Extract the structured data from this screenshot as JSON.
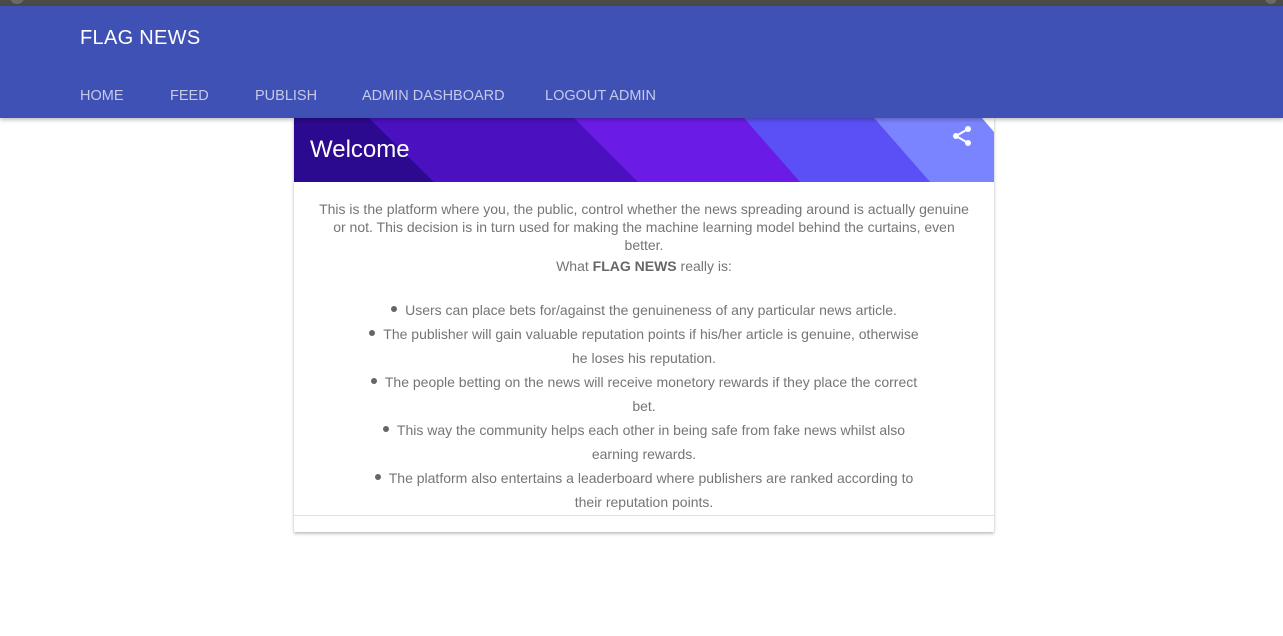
{
  "app": {
    "brand": "FLAG NEWS"
  },
  "nav": {
    "items": [
      {
        "label": "HOME"
      },
      {
        "label": "FEED"
      },
      {
        "label": "PUBLISH"
      },
      {
        "label": "ADMIN DASHBOARD"
      },
      {
        "label": "LOGOUT ADMIN"
      }
    ]
  },
  "card": {
    "title": "Welcome",
    "share_icon": "share-icon",
    "intro": "This is the platform where you, the public, control whether the news spreading around is actually genuine or not. This decision is in turn used for making the machine learning model behind the curtains, even better.",
    "whatis_prefix": "What",
    "whatis_brand": "FLAG NEWS",
    "whatis_suffix": "really is:",
    "features": [
      "Users can place bets for/against the genuineness of any particular news article.",
      "The publisher will gain valuable reputation points if his/her article is genuine, otherwise he loses his reputation.",
      "The people betting on the news will receive monetory rewards if they place the correct bet.",
      "This way the community helps each other in being safe from fake news whilst also earning rewards.",
      "The platform also entertains a leaderboard where publishers are ranked according to their reputation points."
    ]
  },
  "colors": {
    "header": "#3f51b5",
    "nav_text": "#c5cae9",
    "body_text": "#757575",
    "banner_dark": "#2a0a8c",
    "banner_mid": "#5c1fe0",
    "banner_light": "#6a6cff",
    "banner_pale": "#8c8cff"
  }
}
